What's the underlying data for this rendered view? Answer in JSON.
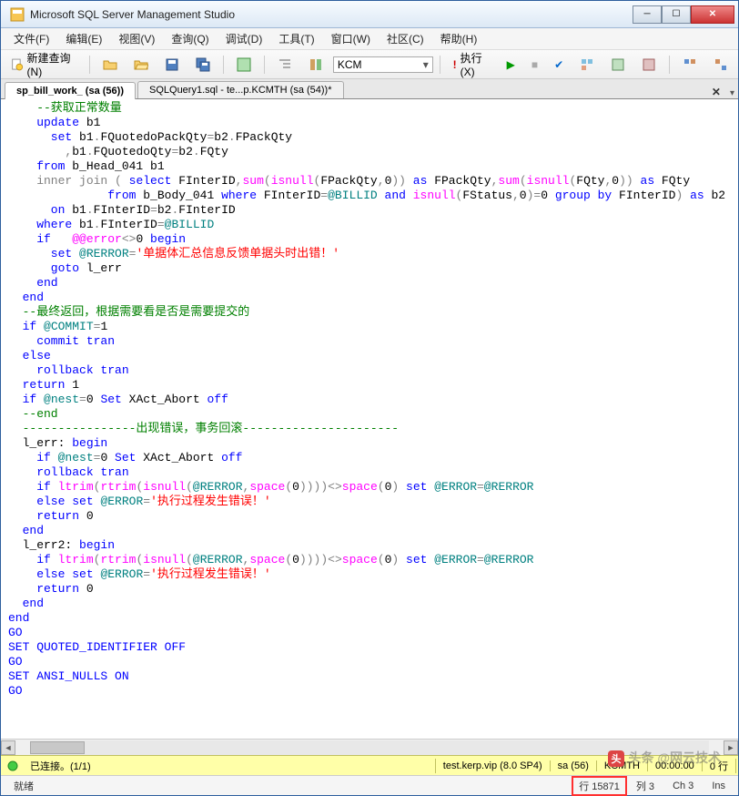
{
  "window": {
    "title": "Microsoft SQL Server Management Studio"
  },
  "menu": {
    "file": "文件(F)",
    "edit": "编辑(E)",
    "view": "视图(V)",
    "query": "查询(Q)",
    "debug": "调试(D)",
    "tools": "工具(T)",
    "window": "窗口(W)",
    "community": "社区(C)",
    "help": "帮助(H)"
  },
  "toolbar": {
    "new_query": "新建查询(N)",
    "db_combo": "KCM",
    "execute": "执行(X)"
  },
  "tabs": {
    "t1": "sp_bill_work_                       (sa (56))",
    "t2": "SQLQuery1.sql - te...p.KCMTH (sa (54))*"
  },
  "code": {
    "l1": "    --获取正常数量",
    "l2a": "    update",
    "l2b": " b1",
    "l3a": "      set",
    "l3b": " b1",
    "l3c": ".",
    "l3d": "FQuotedoPackQty",
    "l3e": "=",
    "l3f": "b2",
    "l3g": ".",
    "l3h": "FPackQty",
    "l4a": "        ,b1.FQuotedoQty=b2.FQty",
    "l5a": "    from",
    "l5b": " b_Head_041 b1",
    "l6a": "    inner",
    "l6b": " join",
    "l6c": " (",
    "l6d": " select",
    "l6e": " FInterID",
    "l6f": ",",
    "l6g": "sum",
    "l6h": "(",
    "l6i": "isnull",
    "l6j": "(",
    "l6k": "FPackQty",
    "l6l": ",",
    "l6m": "0",
    "l6n": "))",
    "l6o": " as",
    "l6p": " FPackQty",
    "l6q": ",",
    "l6r": "sum",
    "l6s": "(",
    "l6t": "isnull",
    "l6u": "(",
    "l6v": "FQty",
    "l6w": ",",
    "l6x": "0",
    "l6y": "))",
    "l6z": " as",
    "l6aa": " FQty",
    "l7a": "              from",
    "l7b": " b_Body_041 ",
    "l7c": "where",
    "l7d": " FInterID",
    "l7e": "=",
    "l7f": "@BILLID ",
    "l7g": "and",
    "l7h": " isnull",
    "l7i": "(",
    "l7j": "FStatus",
    "l7k": ",",
    "l7l": "0",
    "l7m": ")=",
    "l7n": "0 ",
    "l7o": "group",
    "l7p": " by",
    "l7q": " FInterID",
    "l7r": ")",
    "l7s": " as",
    "l7t": " b2",
    "l8a": "      on",
    "l8b": " b1",
    "l8c": ".",
    "l8d": "FInterID",
    "l8e": "=",
    "l8f": "b2",
    "l8g": ".",
    "l8h": "FInterID",
    "l9a": "    where",
    "l9b": " b1",
    "l9c": ".",
    "l9d": "FInterID",
    "l9e": "=",
    "l9f": "@BILLID",
    "l10a": "    if",
    "l10b": "   @@error",
    "l10c": "<>",
    "l10d": "0 ",
    "l10e": "begin",
    "l11a": "      set",
    "l11b": " @RERROR",
    "l11c": "=",
    "l11d": "'单据体汇总信息反馈单据头时出错！'",
    "l12a": "      goto",
    "l12b": " l_err",
    "l13a": "    end",
    "l14a": "  end",
    "l15": "  --最终返回，根据需要看是否是需要提交的",
    "l16a": "  if",
    "l16b": " @COMMIT",
    "l16c": "=",
    "l16d": "1",
    "l17a": "    commit",
    "l17b": " tran",
    "l18a": "  else",
    "l19a": "    rollback",
    "l19b": " tran",
    "l20a": "  return",
    "l20b": " 1",
    "l21a": "  if",
    "l21b": " @nest",
    "l21c": "=",
    "l21d": "0 ",
    "l21e": "Set",
    "l21f": " XAct_Abort ",
    "l21g": "off",
    "l22": "  --end",
    "l23": "  ----------------出现错误，事务回滚----------------------",
    "l24a": "  l_err: ",
    "l24b": "begin",
    "l25a": "    if",
    "l25b": " @nest",
    "l25c": "=",
    "l25d": "0 ",
    "l25e": "Set",
    "l25f": " XAct_Abort ",
    "l25g": "off",
    "l26a": "    rollback",
    "l26b": " tran",
    "l27a": "    if",
    "l27b": " ltrim",
    "l27c": "(",
    "l27d": "rtrim",
    "l27e": "(",
    "l27f": "isnull",
    "l27g": "(",
    "l27h": "@RERROR",
    "l27i": ",",
    "l27j": "space",
    "l27k": "(",
    "l27l": "0",
    "l27m": "))))<>",
    "l27n": "space",
    "l27o": "(",
    "l27p": "0",
    "l27q": ")",
    "l27r": " set",
    "l27s": " @ERROR",
    "l27t": "=",
    "l27u": "@RERROR",
    "l28a": "    else",
    "l28b": " set",
    "l28c": " @ERROR",
    "l28d": "=",
    "l28e": "'执行过程发生错误！'",
    "l29a": "    return",
    "l29b": " 0",
    "l30a": "  end",
    "l31a": "  l_err2: ",
    "l31b": "begin",
    "l32a": "    if",
    "l32b": " ltrim",
    "l32c": "(",
    "l32d": "rtrim",
    "l32e": "(",
    "l32f": "isnull",
    "l32g": "(",
    "l32h": "@RERROR",
    "l32i": ",",
    "l32j": "space",
    "l32k": "(",
    "l32l": "0",
    "l32m": "))))<>",
    "l32n": "space",
    "l32o": "(",
    "l32p": "0",
    "l32q": ")",
    "l32r": " set",
    "l32s": " @ERROR",
    "l32t": "=",
    "l32u": "@RERROR",
    "l33a": "    else",
    "l33b": " set",
    "l33c": " @ERROR",
    "l33d": "=",
    "l33e": "'执行过程发生错误！'",
    "l34a": "    return",
    "l34b": " 0",
    "l35a": "  end",
    "l36a": "end",
    "l37": "GO",
    "l38a": "SET",
    "l38b": " QUOTED_IDENTIFIER",
    "l38c": " OFF",
    "l39": "GO",
    "l40a": "SET",
    "l40b": " ANSI_NULLS",
    "l40c": " ON",
    "l41": "GO"
  },
  "status1": {
    "connected": "已连接。(1/1)",
    "server": "test.kerp.vip (8.0 SP4)",
    "user": "sa (56)",
    "db": "KCMTH",
    "time": "00:00:00",
    "rows": "0 行"
  },
  "status2": {
    "ready": "就绪",
    "row": "行 15871",
    "col": "列 3",
    "ch": "Ch 3",
    "ins": "Ins"
  },
  "watermark": "头条 @网云技术"
}
